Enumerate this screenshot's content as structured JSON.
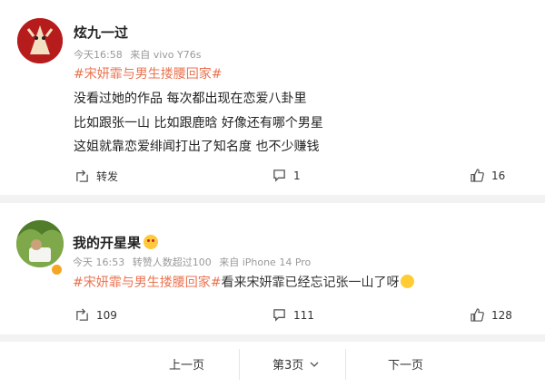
{
  "post1": {
    "username": "炫九一过",
    "time": "今天16:58",
    "source": "来自 vivo Y76s",
    "hashtag": "#宋妍霏与男生搂腰回家#",
    "lines": [
      "没看过她的作品 每次都出现在恋爱八卦里",
      "比如跟张一山 比如跟鹿晗 好像还有哪个男星",
      "这姐就靠恋爱绯闻打出了知名度 也不少赚钱"
    ],
    "repost_label": "转发",
    "comment_count": "1",
    "like_count": "16"
  },
  "post2": {
    "username": "我的开星果",
    "time": "今天 16:53",
    "praise": "转赞人数超过100",
    "source": "来自 iPhone 14 Pro",
    "hashtag": "#宋妍霏与男生搂腰回家#",
    "body": "看来宋妍霏已经忘记张一山了呀",
    "repost_count": "109",
    "comment_count": "111",
    "like_count": "128"
  },
  "pager": {
    "prev": "上一页",
    "current": "第3页",
    "next": "下一页"
  },
  "colors": {
    "hashtag": "#eb7350",
    "text": "#222222",
    "meta": "#999999",
    "background": "#f2f2f2"
  },
  "icons": [
    "repost-icon",
    "comment-icon",
    "like-icon",
    "chevron-down-icon",
    "vip-badge-icon",
    "emoji-icon"
  ]
}
